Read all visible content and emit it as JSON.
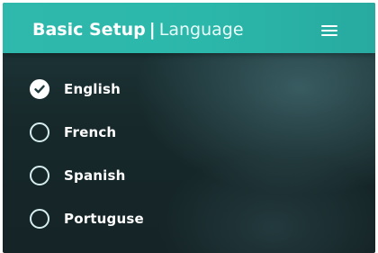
{
  "header": {
    "title_bold": "Basic Setup",
    "separator": "|",
    "title_light": "Language",
    "menu_icon": "hamburger-menu-icon"
  },
  "options": [
    {
      "label": "English",
      "checked": true
    },
    {
      "label": "French",
      "checked": false
    },
    {
      "label": "Spanish",
      "checked": false
    },
    {
      "label": "Portuguse",
      "checked": false
    }
  ],
  "colors": {
    "header": "#2fb9ac",
    "background": "#1a2f31",
    "check": "#1f3a3d",
    "text": "#ffffff"
  }
}
